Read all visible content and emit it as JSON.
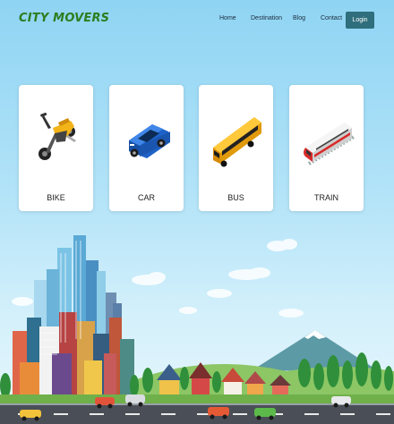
{
  "brand": {
    "name": "CITY MOVERS"
  },
  "nav": {
    "links": [
      "Home",
      "Destination",
      "Blog",
      "Contact"
    ],
    "login_label": "Login"
  },
  "cards": [
    {
      "label": "BIKE",
      "icon": "motorbike-icon"
    },
    {
      "label": "CAR",
      "icon": "car-icon"
    },
    {
      "label": "BUS",
      "icon": "bus-icon"
    },
    {
      "label": "TRAIN",
      "icon": "train-icon"
    }
  ],
  "colors": {
    "brand": "#2e7d1f",
    "login_button": "#2f6e7c",
    "sky": "#8fd4f3"
  }
}
